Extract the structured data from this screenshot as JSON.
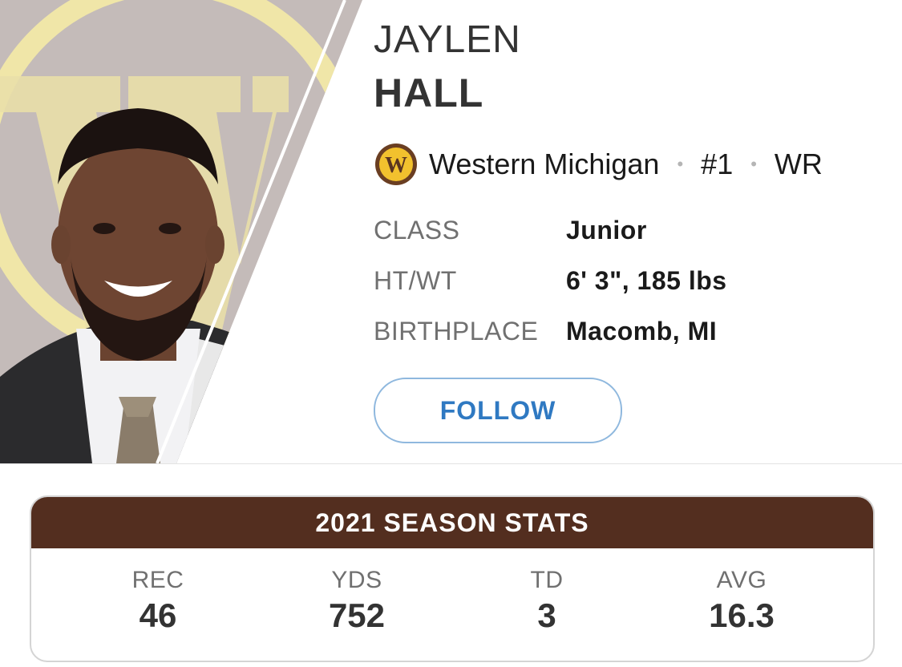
{
  "player": {
    "first_name": "JAYLEN",
    "last_name": "HALL",
    "team": "Western Michigan",
    "number": "#1",
    "position": "WR",
    "separator": "•"
  },
  "team_logo": {
    "letter": "W",
    "colors": {
      "ring": "#6a3e22",
      "fill": "#f2c12e",
      "letter": "#5a3420"
    }
  },
  "attributes": [
    {
      "label": "CLASS",
      "value": "Junior"
    },
    {
      "label": "HT/WT",
      "value": "6' 3\", 185 lbs"
    },
    {
      "label": "BIRTHPLACE",
      "value": "Macomb, MI"
    }
  ],
  "follow_button": {
    "label": "FOLLOW"
  },
  "stats": {
    "title": "2021 SEASON STATS",
    "items": [
      {
        "label": "REC",
        "value": "46"
      },
      {
        "label": "YDS",
        "value": "752"
      },
      {
        "label": "TD",
        "value": "3"
      },
      {
        "label": "AVG",
        "value": "16.3"
      }
    ]
  },
  "colors": {
    "stats_header": "#532e1f",
    "follow_text": "#2f79c2",
    "follow_border": "#8fb8de",
    "label_gray": "#707070"
  }
}
